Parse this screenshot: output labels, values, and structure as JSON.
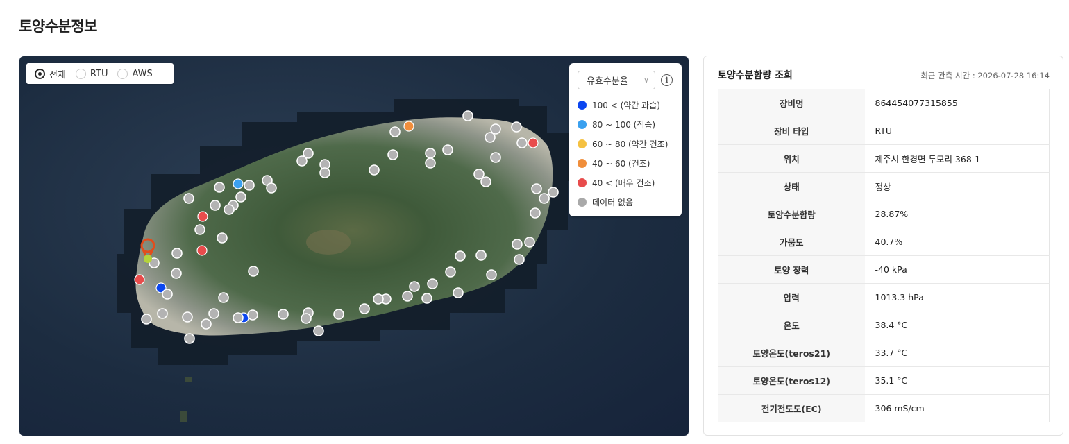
{
  "page": {
    "title": "토양수분정보"
  },
  "map": {
    "filters": [
      {
        "label": "전체",
        "checked": true
      },
      {
        "label": "RTU",
        "checked": false
      },
      {
        "label": "AWS",
        "checked": false
      }
    ],
    "legend": {
      "select_value": "유효수분율",
      "info_icon": "info-icon",
      "items": [
        {
          "label": "100 < (약간 과습)",
          "color": "#0b46f0"
        },
        {
          "label": "80 ~ 100 (적습)",
          "color": "#3aa0ef"
        },
        {
          "label": "60 ~ 80 (약간 건조)",
          "color": "#f5c141"
        },
        {
          "label": "40 ~ 60 (건조)",
          "color": "#f08e3b"
        },
        {
          "label": "40 < (매우 건조)",
          "color": "#e84c4c"
        },
        {
          "label": "데이터 없음",
          "color": "#a9a9a9"
        }
      ]
    },
    "selected_marker_color": "#e34d1c"
  },
  "panel": {
    "title": "토양수분함량 조회",
    "time": "최근 관측 시간 : 2026-07-28 16:14",
    "rows": [
      {
        "key": "장비명",
        "value": "864454077315855"
      },
      {
        "key": "장비 타입",
        "value": "RTU"
      },
      {
        "key": "위치",
        "value": "제주시 한경면 두모리 368-1"
      },
      {
        "key": "상태",
        "value": "정상"
      },
      {
        "key": "토양수분함량",
        "value": "28.87%"
      },
      {
        "key": "가뭄도",
        "value": "40.7%"
      },
      {
        "key": "토양 장력",
        "value": "-40 kPa"
      },
      {
        "key": "압력",
        "value": "1013.3 hPa"
      },
      {
        "key": "온도",
        "value": "38.4 °C"
      },
      {
        "key": "토양온도(teros21)",
        "value": "33.7 °C"
      },
      {
        "key": "토양온도(teros12)",
        "value": "35.1 °C"
      },
      {
        "key": "전기전도도(EC)",
        "value": "306 mS/cm"
      }
    ]
  }
}
